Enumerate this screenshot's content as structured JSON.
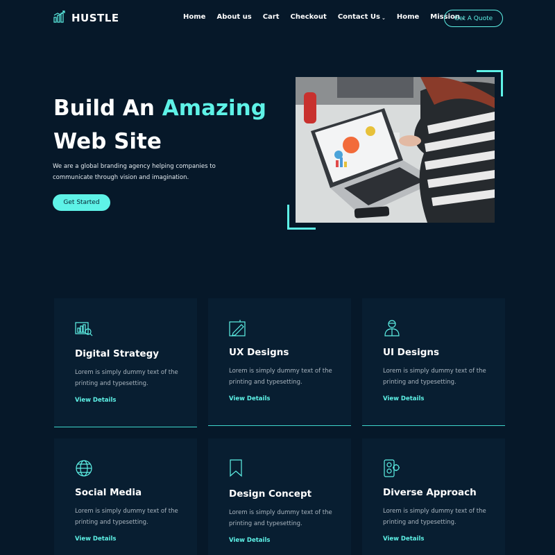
{
  "brand": {
    "name": "HUSTLE"
  },
  "nav": {
    "items": [
      {
        "label": "Home"
      },
      {
        "label": "About us"
      },
      {
        "label": "Cart"
      },
      {
        "label": "Checkout"
      },
      {
        "label": "Contact Us"
      },
      {
        "label": "Home"
      },
      {
        "label": "Mission"
      }
    ],
    "cta": "Get A Quote"
  },
  "hero": {
    "title_line1_prefix": "Build An ",
    "title_line1_accent": "Amazing",
    "title_line2": "Web Site",
    "description": "We are a global branding agency helping companies to communicate through vision and imagination.",
    "button": "Get Started"
  },
  "services": [
    {
      "title": "Digital Strategy",
      "desc": "Lorem is simply dummy text of the printing and typesetting.",
      "link": "View Details",
      "icon": "analytics-icon"
    },
    {
      "title": "UX Designs",
      "desc": "Lorem is simply dummy text of the printing and typesetting.",
      "link": "View Details",
      "icon": "pen-tool-icon"
    },
    {
      "title": "UI Designs",
      "desc": "Lorem is simply dummy text of the printing and typesetting.",
      "link": "View Details",
      "icon": "designer-icon"
    },
    {
      "title": "Social Media",
      "desc": "Lorem is simply dummy text of the printing and typesetting.",
      "link": "View Details",
      "icon": "globe-icon"
    },
    {
      "title": "Design Concept",
      "desc": "Lorem is simply dummy text of the printing and typesetting.",
      "link": "View Details",
      "icon": "bookmark-icon"
    },
    {
      "title": "Diverse Approach",
      "desc": "Lorem is simply dummy text of the printing and typesetting.",
      "link": "View Details",
      "icon": "mobile-gear-icon"
    }
  ],
  "colors": {
    "background": "#061829",
    "card": "#081e31",
    "accent": "#5ef2e7"
  }
}
